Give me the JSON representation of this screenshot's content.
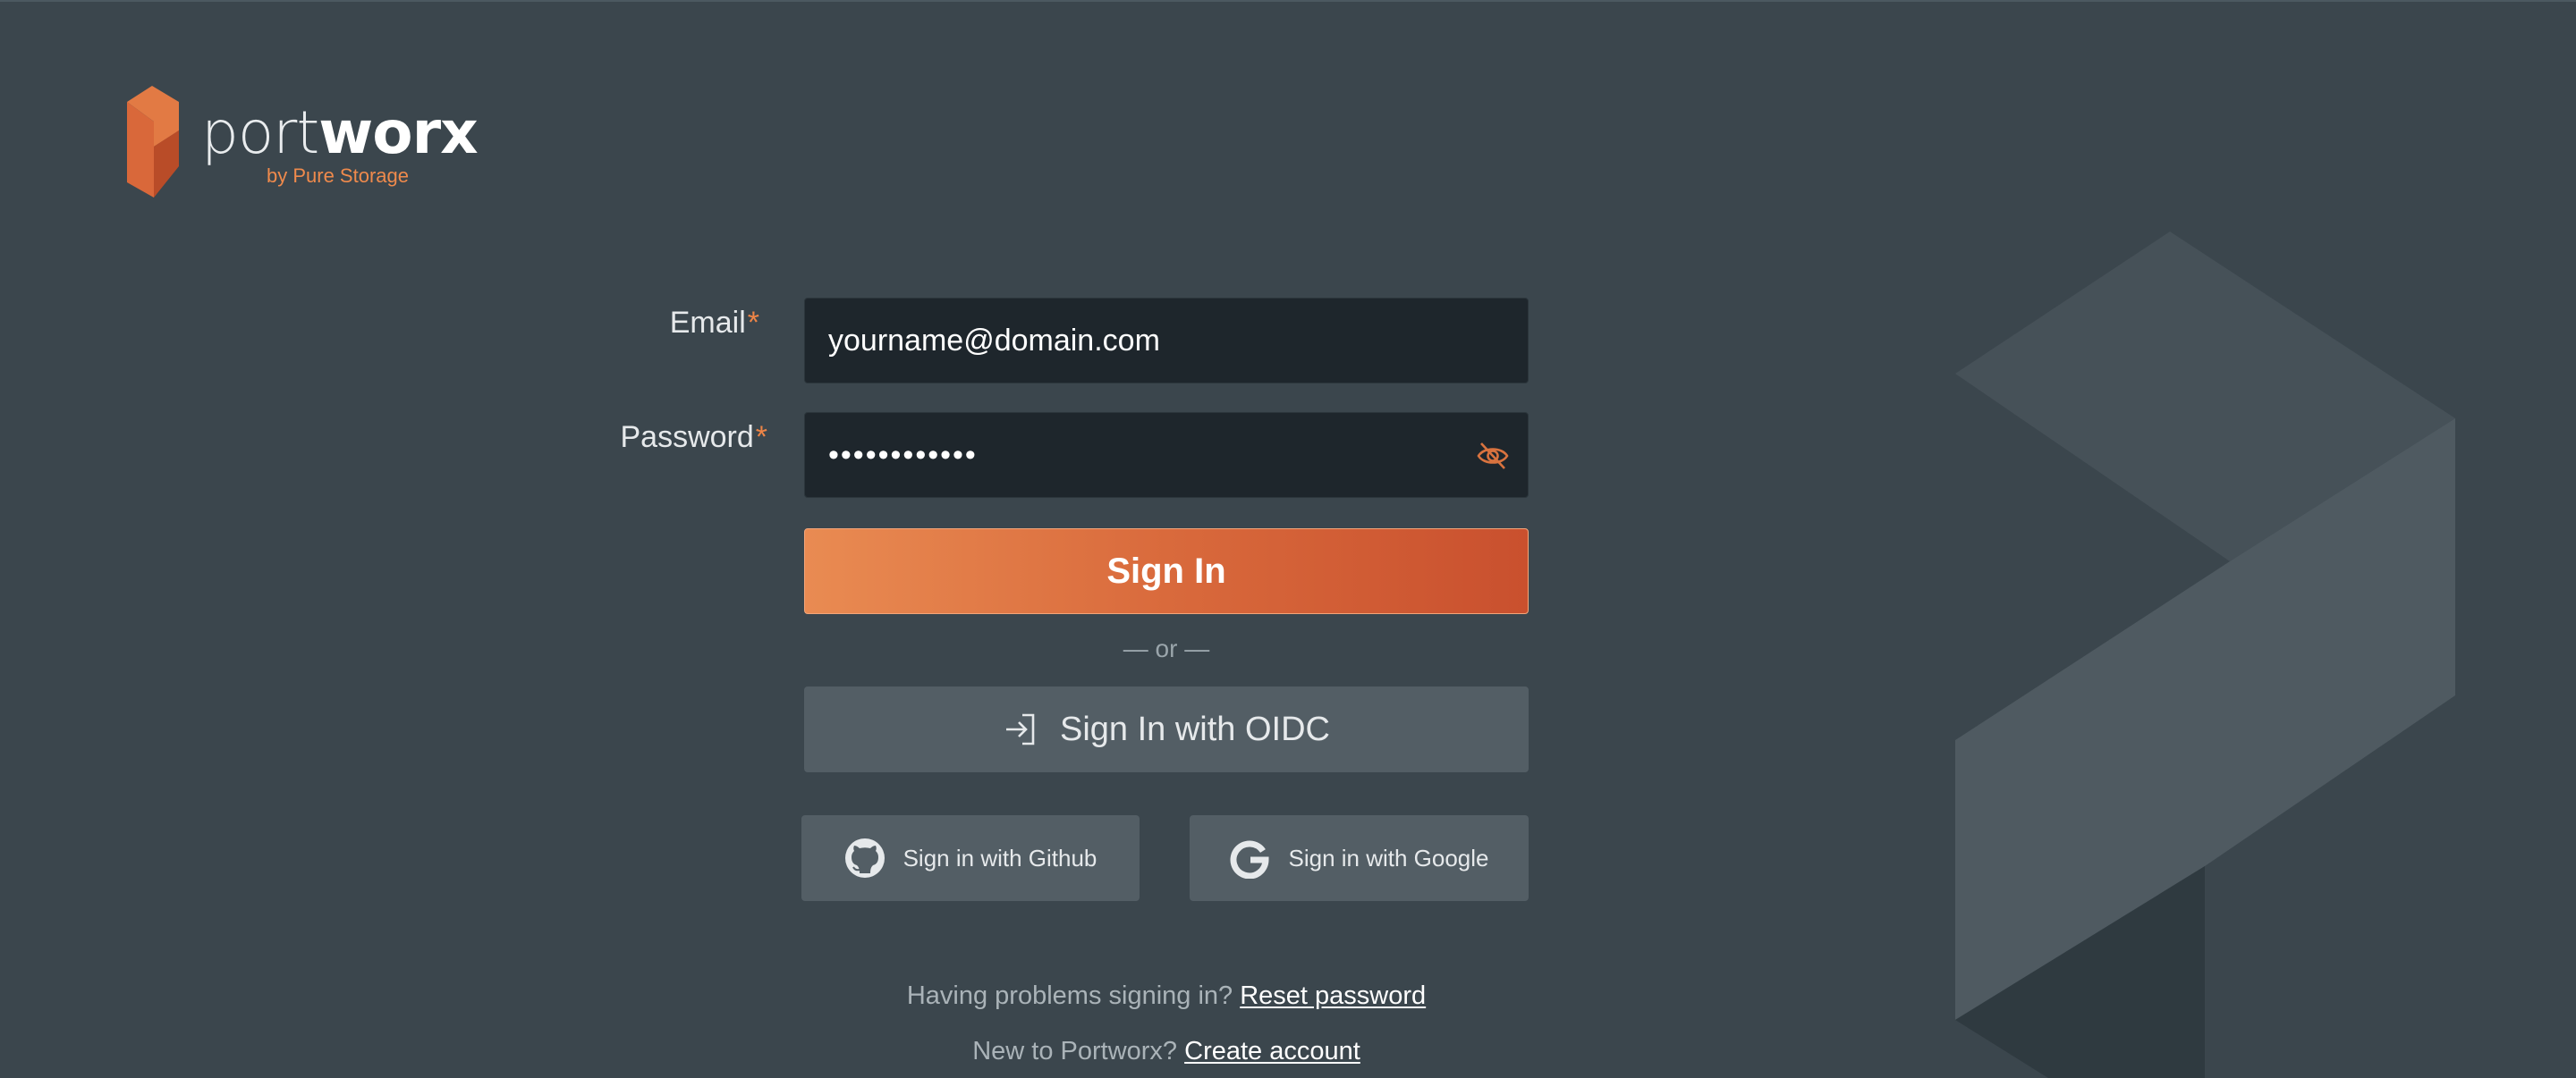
{
  "brand": {
    "name_light": "port",
    "name_bold": "worx",
    "tagline": "by Pure Storage",
    "accent_color": "#ee8547"
  },
  "form": {
    "email_label": "Email",
    "password_label": "Password",
    "required_marker": "*",
    "email_value": "yourname@domain.com",
    "password_value": "••••••••••••",
    "show_password_icon": "eye-slash-icon"
  },
  "actions": {
    "sign_in_label": "Sign In",
    "or_text": "— or —",
    "oidc_label": "Sign In with OIDC",
    "github_label": "Sign in with Github",
    "google_label": "Sign in with Google"
  },
  "footer": {
    "problems_text": "Having problems signing in?",
    "reset_link": "Reset password",
    "new_text": "New to Portworx?",
    "create_link": "Create account"
  }
}
